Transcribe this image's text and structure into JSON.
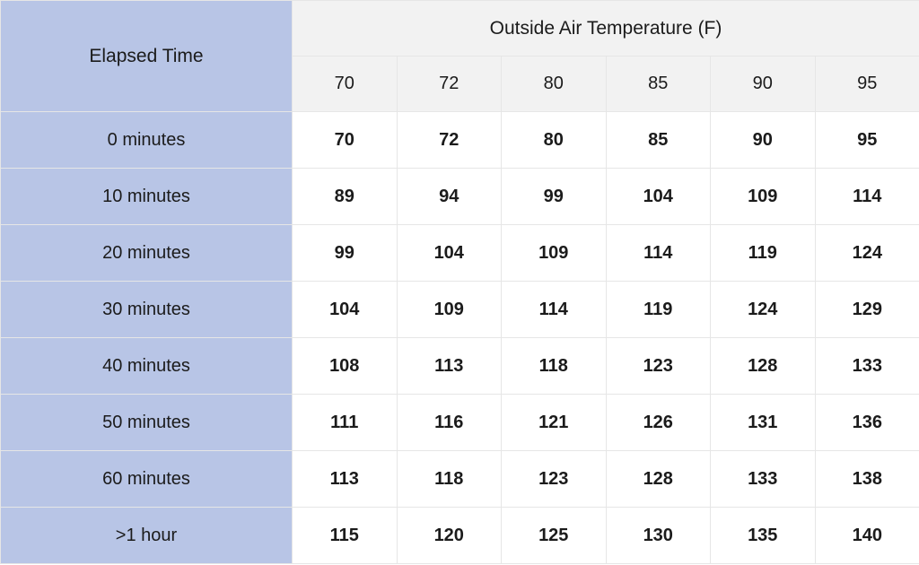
{
  "chart_data": {
    "type": "table",
    "title": "Outside Air Temperature (F)",
    "row_header": "Elapsed Time",
    "columns": [
      "70",
      "72",
      "80",
      "85",
      "90",
      "95"
    ],
    "rows": [
      {
        "label": "0 minutes",
        "values": [
          70,
          72,
          80,
          85,
          90,
          95
        ]
      },
      {
        "label": "10 minutes",
        "values": [
          89,
          94,
          99,
          104,
          109,
          114
        ]
      },
      {
        "label": "20 minutes",
        "values": [
          99,
          104,
          109,
          114,
          119,
          124
        ]
      },
      {
        "label": "30 minutes",
        "values": [
          104,
          109,
          114,
          119,
          124,
          129
        ]
      },
      {
        "label": "40 minutes",
        "values": [
          108,
          113,
          118,
          123,
          128,
          133
        ]
      },
      {
        "label": "50 minutes",
        "values": [
          111,
          116,
          121,
          126,
          131,
          136
        ]
      },
      {
        "label": "60 minutes",
        "values": [
          113,
          118,
          123,
          128,
          133,
          138
        ]
      },
      {
        "label": ">1 hour",
        "values": [
          115,
          120,
          125,
          130,
          135,
          140
        ]
      }
    ]
  }
}
